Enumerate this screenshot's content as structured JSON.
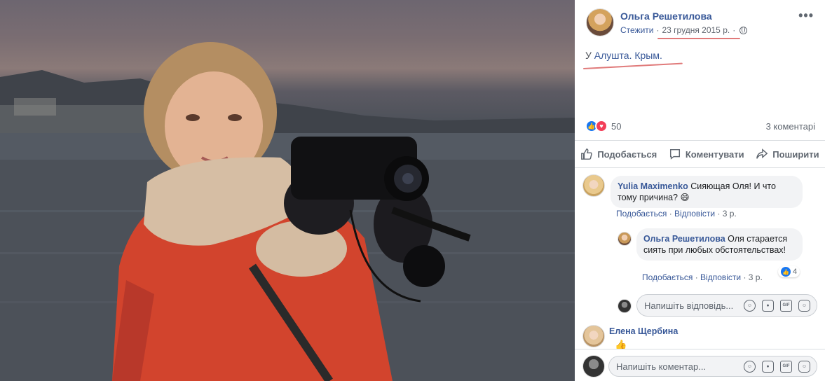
{
  "post": {
    "author": "Ольга Решетилова",
    "follow_label": "Стежити",
    "separator": "·",
    "date": "23 грудня 2015 р.",
    "location_prefix": "У",
    "location": "Алушта. Крым.",
    "reaction_count": "50",
    "comments_count": "3 коментарі"
  },
  "actions": {
    "like": "Подобається",
    "comment": "Коментувати",
    "share": "Поширити"
  },
  "comments": [
    {
      "author": "Yulia Maximenko",
      "text": "Сияющая Оля! И что тому причина? 😄",
      "like_label": "Подобається",
      "reply_label": "Відповісти",
      "time": "3 р."
    },
    {
      "author": "Ольга Решетилова",
      "text": "Оля старается сиять при любых обстоятельствах!",
      "like_label": "Подобається",
      "reply_label": "Відповісти",
      "time": "3 р.",
      "likes": "4"
    },
    {
      "author": "Елена Щербина",
      "text": "👍"
    }
  ],
  "reply_input": {
    "placeholder": "Напишіть відповідь..."
  },
  "comment_input": {
    "placeholder": "Напишіть коментар..."
  },
  "input_icons": [
    "emoji-icon",
    "camera-icon",
    "gif-icon",
    "sticker-icon"
  ],
  "colors": {
    "link": "#385898",
    "like": "#1877f2",
    "love": "#f33e58",
    "annotation": "#e07a7a"
  }
}
